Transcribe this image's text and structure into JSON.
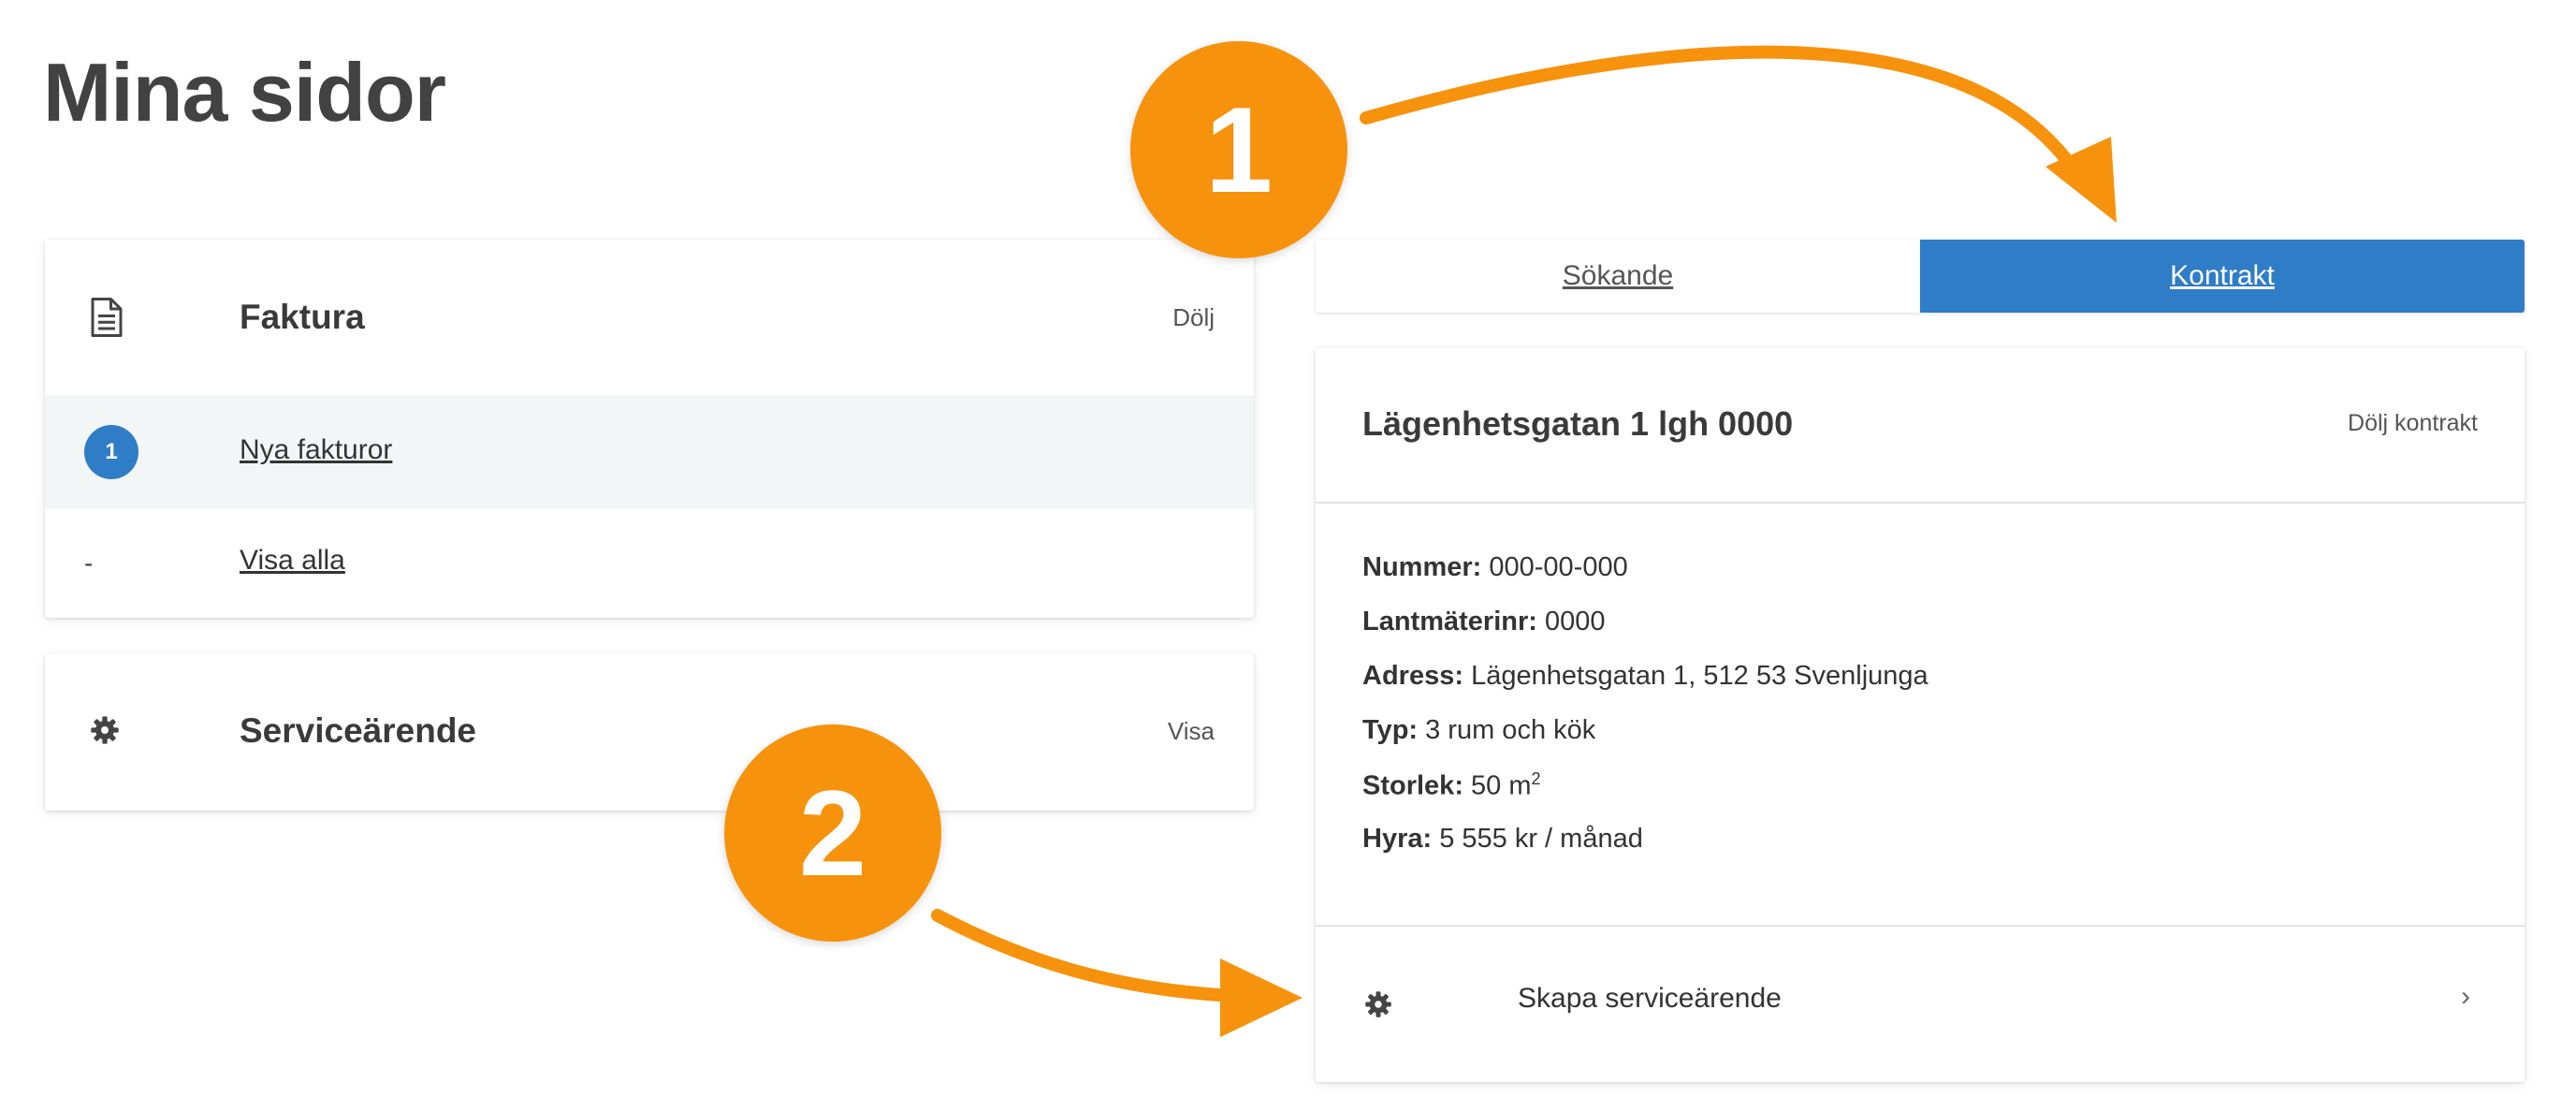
{
  "page": {
    "title": "Mina sidor"
  },
  "faktura": {
    "title": "Faktura",
    "toggle": "Dölj",
    "icon": "document-icon",
    "rows": [
      {
        "badge": "1",
        "label": "Nya fakturor"
      },
      {
        "marker": "-",
        "label": "Visa alla"
      }
    ]
  },
  "service": {
    "title": "Serviceärende",
    "toggle": "Visa",
    "icon": "gear-icon"
  },
  "tabs": [
    {
      "label": "Sökande",
      "active": false
    },
    {
      "label": "Kontrakt",
      "active": true
    }
  ],
  "contract": {
    "title": "Lägenhetsgatan 1 lgh 0000",
    "toggle": "Dölj kontrakt",
    "details": [
      {
        "label": "Nummer:",
        "value": "000-00-000"
      },
      {
        "label": "Lantmäterinr:",
        "value": "0000"
      },
      {
        "label": "Adress:",
        "value": "Lägenhetsgatan 1, 512 53 Svenljunga"
      },
      {
        "label": "Typ:",
        "value": "3 rum och kök"
      },
      {
        "label": "Storlek:",
        "value": "50 m",
        "sup": "2"
      },
      {
        "label": "Hyra:",
        "value": "5 555 kr / månad"
      }
    ],
    "action": {
      "label": "Skapa serviceärende",
      "icon": "gear-icon",
      "chevron": "›"
    }
  },
  "annotations": [
    {
      "label": "1"
    },
    {
      "label": "2"
    }
  ],
  "colors": {
    "accent": "#2f7cc7",
    "marker": "#f7920d",
    "row_highlight": "#f3f6f7",
    "title_text": "#424242"
  }
}
